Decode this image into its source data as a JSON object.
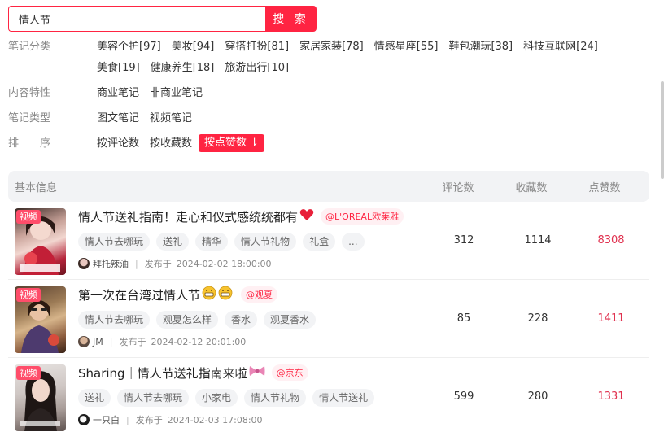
{
  "search": {
    "value": "情人节",
    "button_label": "搜 索"
  },
  "filters": [
    {
      "label": "笔记分类",
      "options": [
        "美容个护[97]",
        "美妆[94]",
        "穿搭打扮[81]",
        "家居家装[78]",
        "情感星座[55]",
        "鞋包潮玩[38]",
        "科技互联网[24]",
        "美食[19]",
        "健康养生[18]",
        "旅游出行[10]"
      ]
    },
    {
      "label": "内容特性",
      "options": [
        "商业笔记",
        "非商业笔记"
      ]
    },
    {
      "label": "笔记类型",
      "options": [
        "图文笔记",
        "视频笔记"
      ]
    },
    {
      "label": "排　　序",
      "options": [
        "按评论数",
        "按收藏数",
        "按点赞数 ⇂"
      ],
      "active_index": 2
    }
  ],
  "table": {
    "headers": {
      "info": "基本信息",
      "comments": "评论数",
      "favorites": "收藏数",
      "likes": "点赞数"
    },
    "rows": [
      {
        "badge": "视频",
        "title": "情人节送礼指南！走心和仪式感统统都有",
        "emoji": "heart-emoji",
        "brand": "@L'OREAL欧莱雅",
        "tags": [
          "情人节去哪玩",
          "送礼",
          "精华",
          "情人节礼物",
          "礼盒",
          "..."
        ],
        "author": "拜托辣油",
        "published_prefix": "发布于",
        "published": "2024-02-02 18:00:00",
        "comments": "312",
        "favorites": "1114",
        "likes": "8308"
      },
      {
        "badge": "视频",
        "title": "第一次在台湾过情人节",
        "emoji": "grin-emoji",
        "brand": "@观夏",
        "tags": [
          "情人节去哪玩",
          "观夏怎么样",
          "香水",
          "观夏香水"
        ],
        "author": "JM",
        "published_prefix": "发布于",
        "published": "2024-02-12 20:01:00",
        "comments": "85",
        "favorites": "228",
        "likes": "1411"
      },
      {
        "badge": "视频",
        "title": "Sharing｜情人节送礼指南来啦",
        "emoji": "bow-emoji",
        "brand": "@京东",
        "tags": [
          "送礼",
          "情人节去哪玩",
          "小家电",
          "情人节礼物",
          "情人节送礼"
        ],
        "author": "一只白",
        "published_prefix": "发布于",
        "published": "2024-02-03 17:08:00",
        "comments": "599",
        "favorites": "280",
        "likes": "1331"
      }
    ]
  },
  "colors": {
    "accent": "#ff2442",
    "likes": "#e0304e",
    "header_bg": "#f2f3f5",
    "tag_bg": "#f2f3f5",
    "brand_bg": "#fff0f3"
  }
}
